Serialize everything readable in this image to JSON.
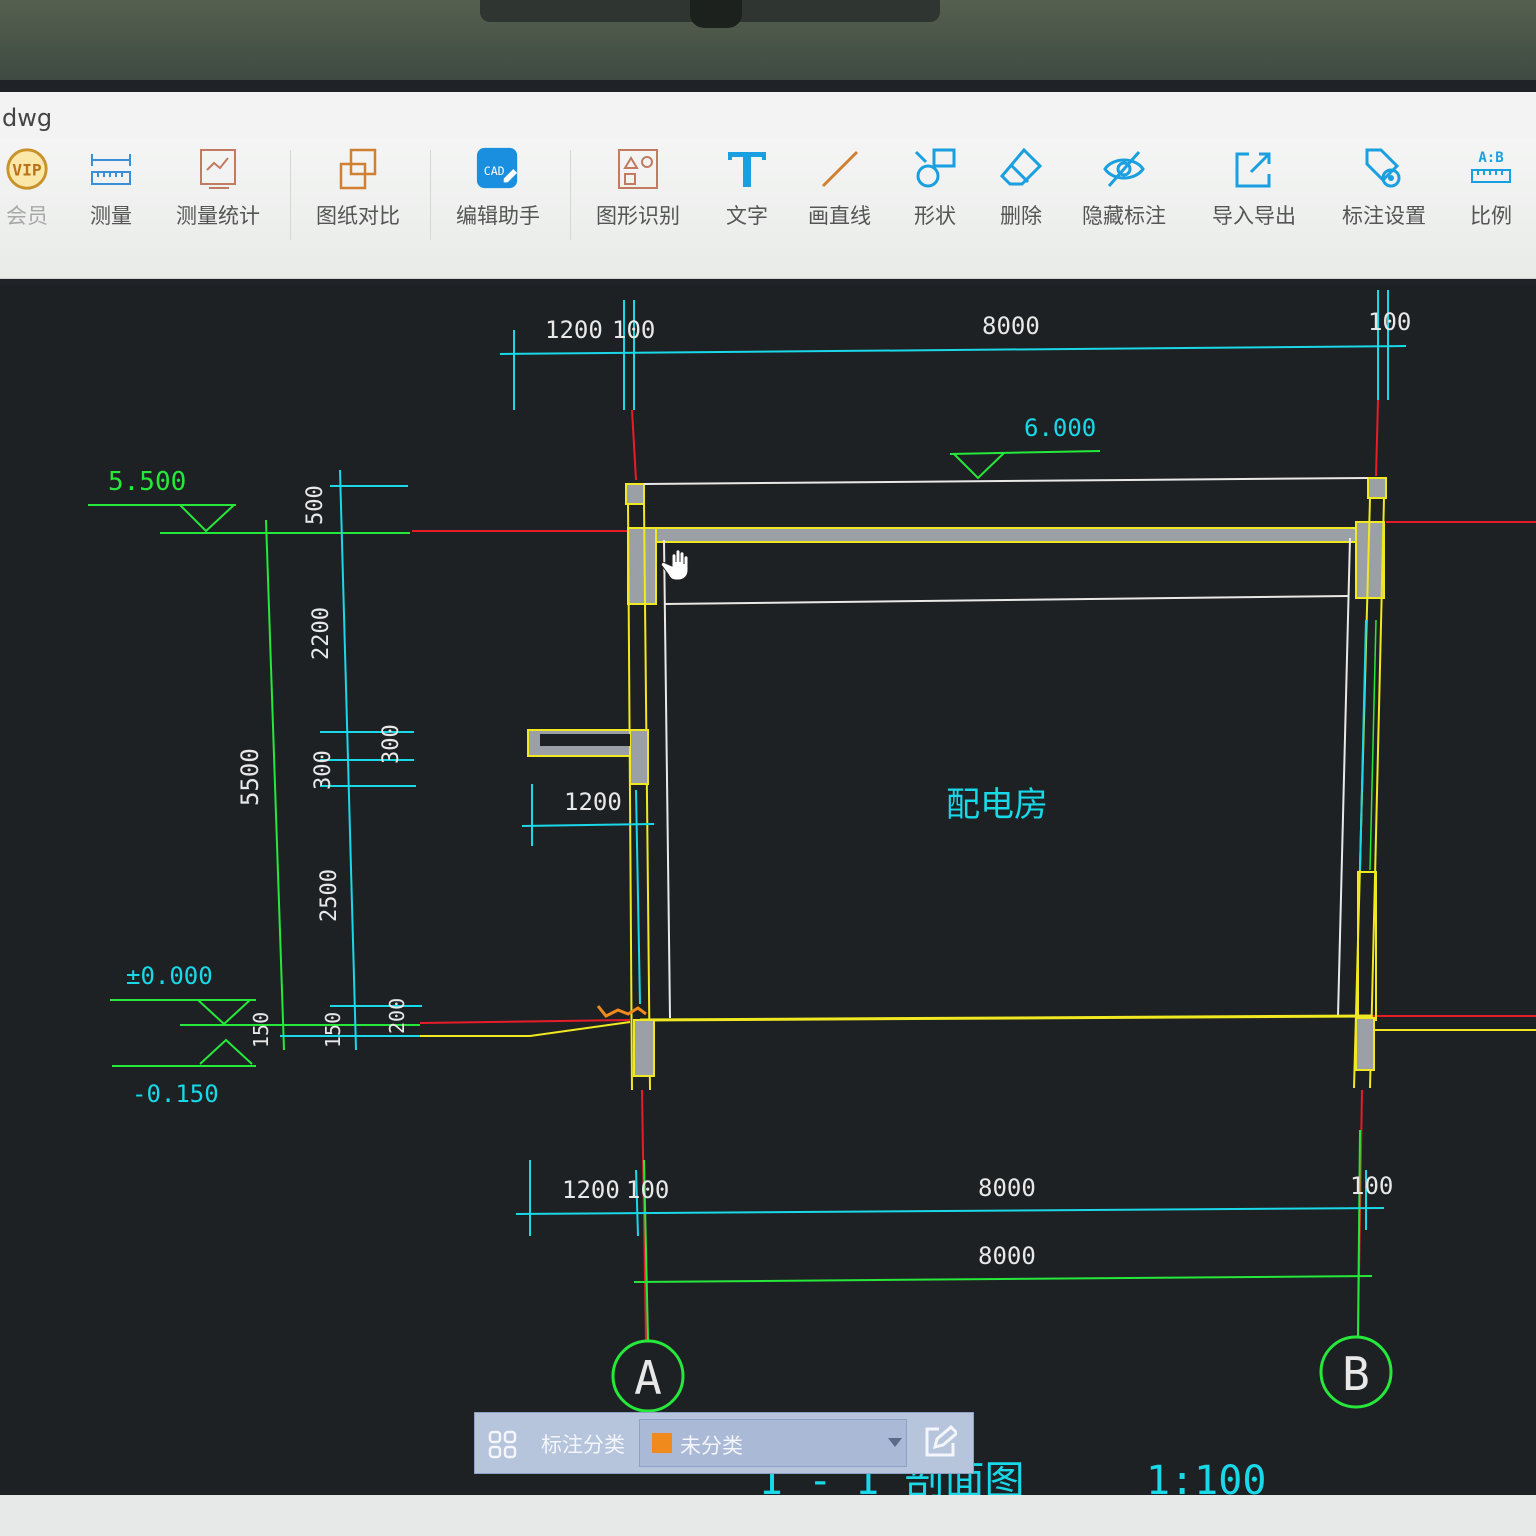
{
  "window": {
    "title": "dwg"
  },
  "toolbar": {
    "items": [
      {
        "label": "会员",
        "icon": "vip-badge-icon"
      },
      {
        "label": "测量",
        "icon": "ruler-measure-icon"
      },
      {
        "label": "测量统计",
        "icon": "measure-statistics-icon"
      },
      {
        "label": "图纸对比",
        "icon": "drawing-compare-icon"
      },
      {
        "label": "编辑助手",
        "icon": "cad-edit-assistant-icon"
      },
      {
        "label": "图形识别",
        "icon": "shape-recognition-icon"
      },
      {
        "label": "文字",
        "icon": "text-tool-icon"
      },
      {
        "label": "画直线",
        "icon": "draw-line-icon"
      },
      {
        "label": "形状",
        "icon": "shape-tool-icon"
      },
      {
        "label": "删除",
        "icon": "eraser-icon"
      },
      {
        "label": "隐藏标注",
        "icon": "hide-annotation-icon"
      },
      {
        "label": "导入导出",
        "icon": "import-export-icon"
      },
      {
        "label": "标注设置",
        "icon": "annotation-settings-icon"
      },
      {
        "label": "比例",
        "icon": "scale-ratio-icon"
      }
    ],
    "vip_text": "VIP",
    "cad_text": "CAD",
    "scale_ab_text": "A:B"
  },
  "drawing": {
    "dims_top": [
      "1200",
      "100",
      "8000",
      "100"
    ],
    "dims_bottom_row1": [
      "1200",
      "100",
      "8000",
      "100"
    ],
    "dims_bottom_row2": [
      "8000"
    ],
    "elevations": {
      "top_roof": "6.000",
      "left_top": "5.500",
      "floor": "±0.000",
      "ground": "-0.150"
    },
    "dims_left_outer": [
      "500",
      "2200",
      "300",
      "300",
      "2500",
      "150",
      "150",
      "200"
    ],
    "dim_left_total": "5500",
    "dim_canopy": "1200",
    "room_label": "配电房",
    "axis_labels": [
      "A",
      "B"
    ],
    "drawing_title_partial": "I - I 剖面图",
    "scale_text": "1:100"
  },
  "bottom_bar": {
    "category_label": "标注分类",
    "category_value": "未分类",
    "swatch_color": "#f08a1c"
  },
  "colors": {
    "cad_background": "#1e2124",
    "cyan_dim": "#19d8e8",
    "green": "#26e83a",
    "yellow": "#f0e820",
    "red": "#e81c28",
    "white": "#e8e8e8"
  }
}
